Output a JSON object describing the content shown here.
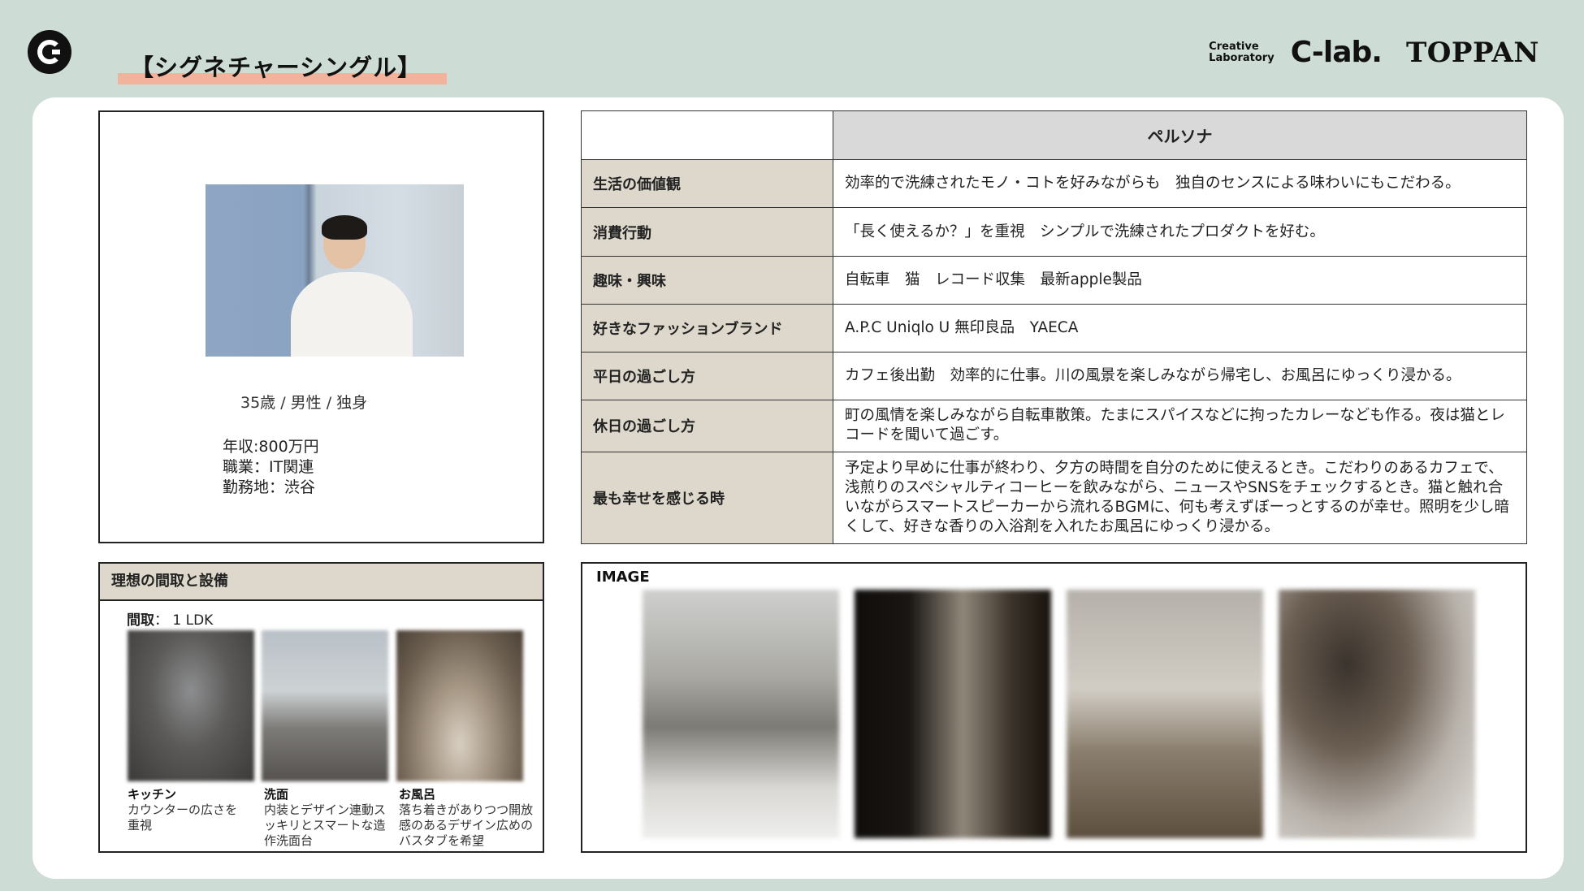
{
  "header": {
    "title": "【シグネチャーシングル】",
    "brand_small_line1": "Creative",
    "brand_small_line2": "Laboratory",
    "brand_clab": "C-lab.",
    "brand_toppan": "TOPPAN"
  },
  "profile": {
    "basic": "35歳 / 男性 / 独身",
    "income": "年収:800万円",
    "job": "職業：IT関連",
    "workplace": "勤務地：渋谷"
  },
  "persona": {
    "header": "ペルソナ",
    "rows": [
      {
        "label": "生活の価値観",
        "value": "効率的で洗練されたモノ・コトを好みながらも　独自のセンスによる味わいにもこだわる。"
      },
      {
        "label": "消費行動",
        "value": "「長く使えるか？」を重視　シンプルで洗練されたプロダクトを好む。"
      },
      {
        "label": "趣味・興味",
        "value": "自転車　猫　レコード収集　最新apple製品"
      },
      {
        "label": "好きなファッションブランド",
        "value": "A.P.C Uniqlo U 無印良品　YAECA"
      },
      {
        "label": "平日の過ごし方",
        "value": "カフェ後出勤　効率的に仕事。川の風景を楽しみながら帰宅し、お風呂にゆっくり浸かる。"
      },
      {
        "label": "休日の過ごし方",
        "value": "町の風情を楽しみながら自転車散策。たまにスパイスなどに拘ったカレーなども作る。夜は猫とレコードを聞いて過ごす。"
      },
      {
        "label": "最も幸せを感じる時",
        "value": "予定より早めに仕事が終わり、夕方の時間を自分のために使えるとき。こだわりのあるカフェで、浅煎りのスペシャルティコーヒーを飲みながら、ニュースやSNSをチェックするとき。猫と触れ合いながらスマートスピーカーから流れるBGMに、何も考えずぼーっとするのが幸せ。照明を少し暗くして、好きな香りの入浴剤を入れたお風呂にゆっくり浸かる。"
      }
    ]
  },
  "layout": {
    "header": "理想の間取と設備",
    "madori_label": "間取",
    "madori_value": "：  1 LDK",
    "rooms": [
      {
        "name": "キッチン",
        "desc": "カウンターの広さを重視"
      },
      {
        "name": "洗面",
        "desc": "内装とデザイン連動スッキリとスマートな造作洗面台"
      },
      {
        "name": "お風呂",
        "desc": "落ち着きがありつつ開放感のあるデザイン広めのバスタブを希望"
      }
    ]
  },
  "image_section": {
    "title": "IMAGE"
  },
  "colors": {
    "background": "#cddcd5",
    "accent_underline": "#f2b29b",
    "label_cell": "#ddd8cb",
    "header_cell": "#d9d9d9"
  }
}
